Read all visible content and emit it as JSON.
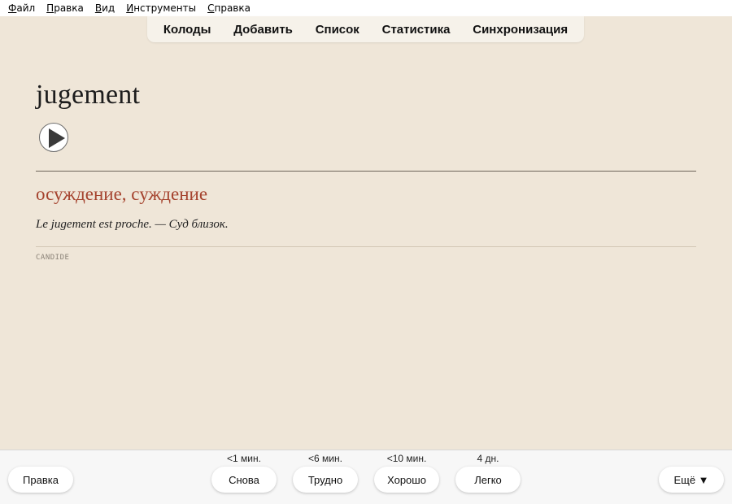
{
  "menubar": {
    "items": [
      {
        "ul": "Ф",
        "rest": "айл"
      },
      {
        "ul": "П",
        "rest": "равка"
      },
      {
        "ul": "В",
        "rest": "ид"
      },
      {
        "ul": "И",
        "rest": "нструменты"
      },
      {
        "ul": "С",
        "rest": "правка"
      }
    ]
  },
  "toolbar": {
    "decks": "Колоды",
    "add": "Добавить",
    "browse": "Список",
    "stats": "Статистика",
    "sync": "Синхронизация"
  },
  "card": {
    "word": "jugement",
    "translation": "осуждение, суждение",
    "example": "Le jugement est proche. — Суд близок.",
    "source": "CANDIDE"
  },
  "bottom": {
    "edit": "Правка",
    "more": "Ещё ▼",
    "answers": [
      {
        "label": "Снова",
        "interval": "<1 мин."
      },
      {
        "label": "Трудно",
        "interval": "<6 мин."
      },
      {
        "label": "Хорошо",
        "interval": "<10 мин."
      },
      {
        "label": "Легко",
        "interval": "4 дн."
      }
    ]
  },
  "icons": {
    "play": "play-icon"
  },
  "colors": {
    "background": "#efe6d8",
    "translation": "#a5432e"
  }
}
